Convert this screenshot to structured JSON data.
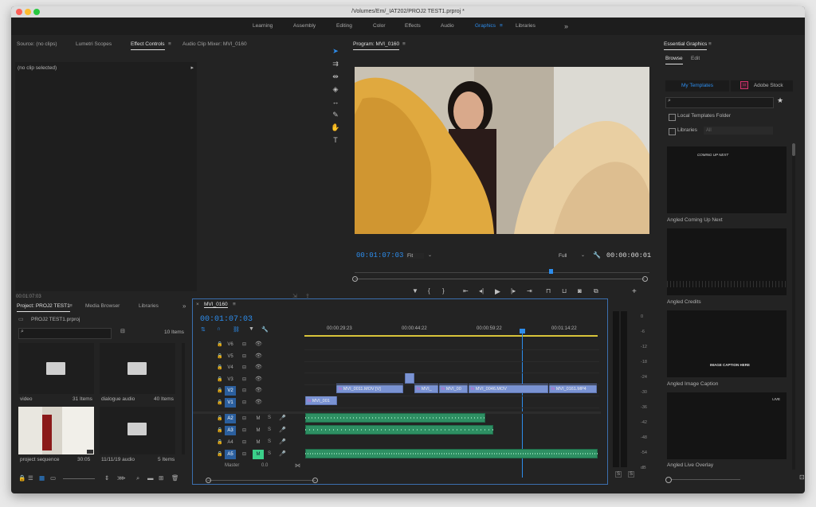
{
  "window": {
    "title": "/Volumes/Em/_IAT202/PROJ2 TEST1.prproj *"
  },
  "workspaces": [
    {
      "label": "Learning"
    },
    {
      "label": "Assembly"
    },
    {
      "label": "Editing"
    },
    {
      "label": "Color"
    },
    {
      "label": "Effects"
    },
    {
      "label": "Audio"
    },
    {
      "label": "Graphics"
    },
    {
      "label": "Libraries"
    }
  ],
  "source_panel": {
    "tabs": [
      "Source: (no clips)",
      "Lumetri Scopes",
      "Effect Controls",
      "Audio Clip Mixer: MVI_0160"
    ],
    "no_clip": "(no clip selected)",
    "timecode": "00:01:07:03"
  },
  "program": {
    "title": "Program: MVI_0160",
    "timecode": "00:01:07:03",
    "fit": "Fit",
    "quality": "Full",
    "duration": "00:00:00:01"
  },
  "essential_graphics": {
    "title": "Essential Graphics",
    "tabs": [
      "Browse",
      "Edit"
    ],
    "my_templates": "My Templates",
    "adobe_stock": "Adobe Stock",
    "local_templates": "Local Templates Folder",
    "libraries": "Libraries",
    "libraries_value": "All",
    "templates": [
      {
        "name": "Angled Coming Up Next",
        "overlay": "COMING UP NEXT"
      },
      {
        "name": "Angled Credits",
        "overlay": ""
      },
      {
        "name": "Angled Image Caption",
        "overlay": "IMAGE CAPTION HERE"
      },
      {
        "name": "Angled Live Overlay",
        "overlay": "LIVE"
      }
    ]
  },
  "project": {
    "tabs": [
      "Project: PROJ2 TEST1",
      "Media Browser",
      "Libraries"
    ],
    "file": "PROJ2 TEST1.prproj",
    "count": "10 Items",
    "items": [
      {
        "name": "video",
        "meta": "31 Items"
      },
      {
        "name": "dialogue audio",
        "meta": "40 Items"
      },
      {
        "name": "project sequence",
        "meta": "30:05"
      },
      {
        "name": "11/11/19 audio",
        "meta": "5 Items"
      }
    ]
  },
  "timeline": {
    "tab": "MVI_0160",
    "timecode": "00:01:07:03",
    "ruler": [
      "00:00:29:23",
      "00:00:44:22",
      "00:00:59:22",
      "00:01:14:22"
    ],
    "video_tracks": [
      "V6",
      "V5",
      "V4",
      "V3",
      "V2",
      "V1"
    ],
    "audio_tracks": [
      "A2",
      "A3",
      "A4",
      "A5"
    ],
    "master_label": "Master",
    "master_value": "0.0",
    "clips": [
      {
        "label": "MVI_0011.MOV [V]"
      },
      {
        "label": "MVI_"
      },
      {
        "label": "MVI_00"
      },
      {
        "label": "MVI_0046.MOV"
      },
      {
        "label": "MVI_0161.MP4"
      },
      {
        "label": "MVI_001"
      }
    ]
  },
  "meter": {
    "scale": [
      "0",
      "-6",
      "-12",
      "-18",
      "-24",
      "-30",
      "-36",
      "-42",
      "-48",
      "-54",
      "dB"
    ],
    "solo": [
      "S",
      "S"
    ]
  },
  "colors": {
    "accent": "#2d8ceb",
    "panel": "#232323",
    "video_clip": "#7a93d3",
    "audio_clip": "#2e8f63"
  }
}
